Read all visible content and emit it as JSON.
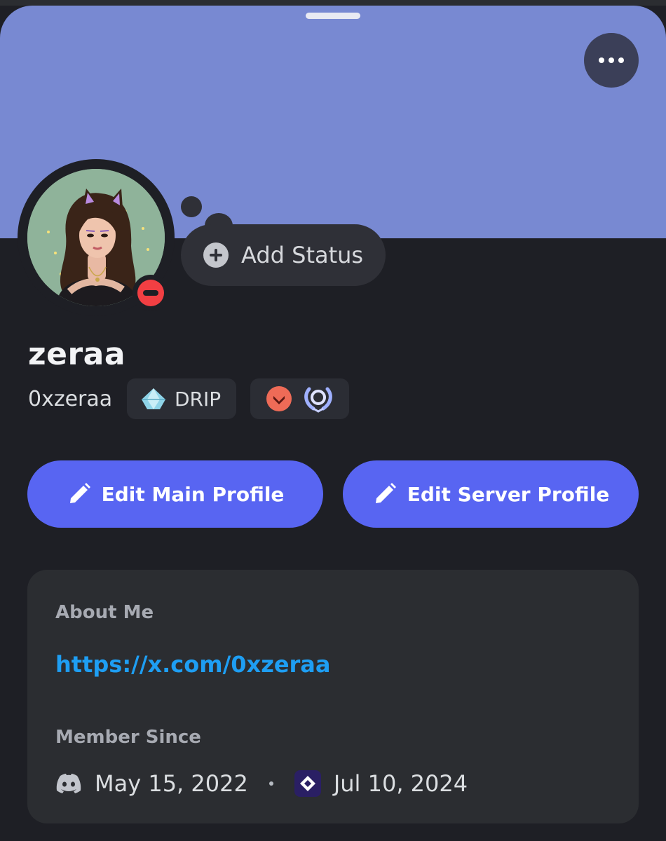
{
  "header": {
    "more_icon": "more-horizontal-icon",
    "banner_color": "#7889d2"
  },
  "status": {
    "add_label": "Add Status",
    "indicator": "do-not-disturb",
    "indicator_color": "#f23f43"
  },
  "profile": {
    "display_name": "zeraa",
    "username": "0xzeraa",
    "server_tag": "DRIP",
    "badges": [
      "orange-chevron-badge-icon",
      "laurel-wreath-badge-icon"
    ]
  },
  "actions": {
    "edit_main_label": "Edit Main Profile",
    "edit_server_label": "Edit Server Profile",
    "accent": "#5865f2"
  },
  "about": {
    "title": "About Me",
    "link": "https://x.com/0xzeraa",
    "link_color": "#1e9ef3"
  },
  "member_since": {
    "title": "Member Since",
    "discord_date": "May 15, 2022",
    "server_date": "Jul 10, 2024"
  }
}
